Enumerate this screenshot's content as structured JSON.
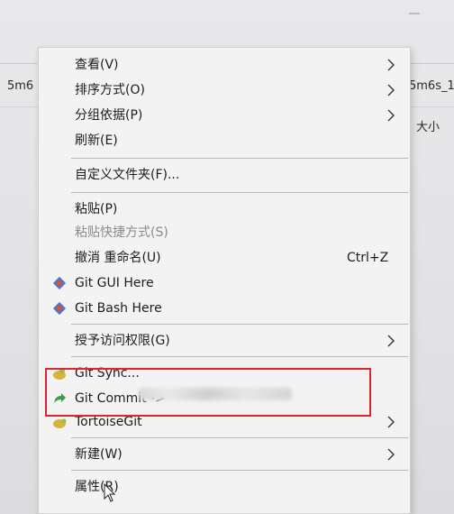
{
  "background": {
    "left_text": "5m6",
    "right_text": "5m6s_1",
    "column_header": "大小"
  },
  "menu": {
    "view": "查看(V)",
    "sort": "排序方式(O)",
    "group": "分组依据(P)",
    "refresh": "刷新(E)",
    "customize": "自定义文件夹(F)...",
    "paste": "粘贴(P)",
    "paste_shortcut": "粘贴快捷方式(S)",
    "undo": "撤消 重命名(U)",
    "undo_shortcut": "Ctrl+Z",
    "git_gui": "Git GUI Here",
    "git_bash": "Git Bash Here",
    "access": "授予访问权限(G)",
    "git_sync": "Git Sync...",
    "git_commit": "Git Commit ->",
    "tortoise": "TortoiseGit",
    "new": "新建(W)",
    "properties": "属性(R)"
  },
  "colors": {
    "highlight_border": "#e0262c",
    "menu_bg": "#f3f3f4"
  }
}
